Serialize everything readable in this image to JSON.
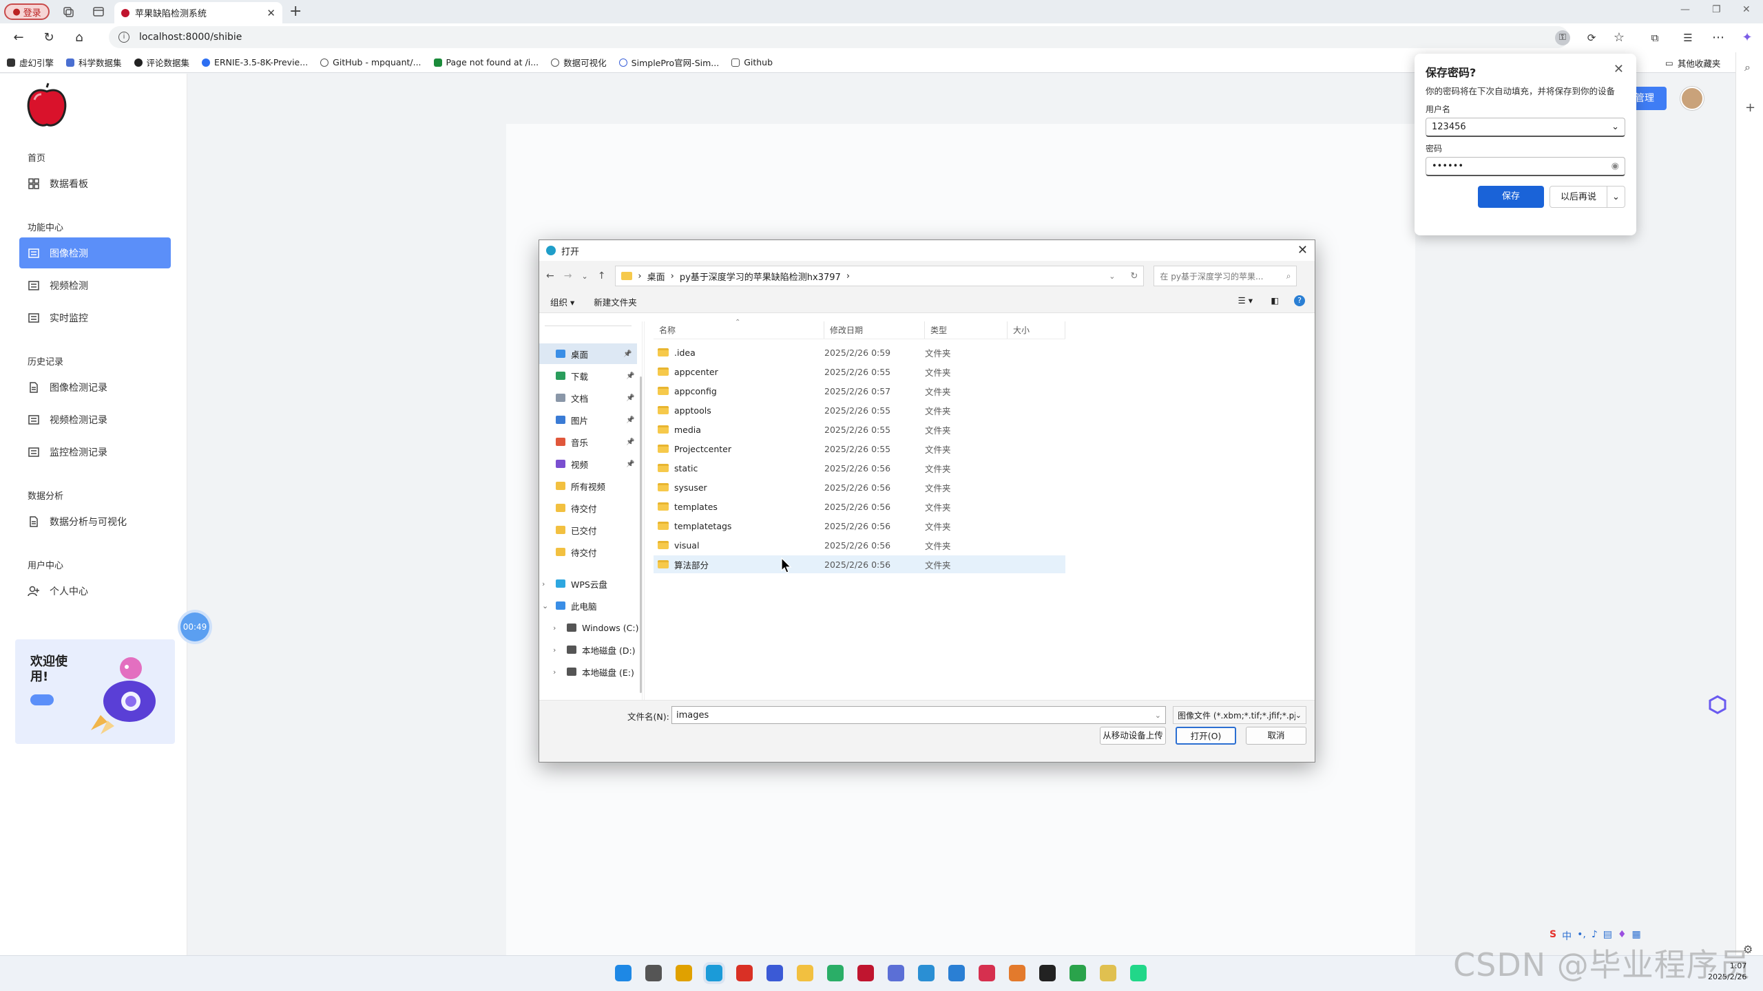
{
  "browser": {
    "profile_label": "登录",
    "tab_title": "苹果缺陷检测系统",
    "url": "localhost:8000/shibie",
    "bookmarks": [
      "虚幻引擎",
      "科学数据集",
      "评论数据集",
      "ERNIE-3.5-8K-Previe...",
      "GitHub - mpquant/...",
      "Page not found at /i...",
      "数据可视化",
      "SimplePro官网-Sim...",
      "Github"
    ],
    "other_bookmarks": "其他收藏夹"
  },
  "sidebar": {
    "sections": [
      {
        "title": "首页",
        "items": [
          {
            "label": "数据看板",
            "icon": "grid-icon"
          }
        ]
      },
      {
        "title": "功能中心",
        "items": [
          {
            "label": "图像检测",
            "icon": "doc-icon",
            "active": true
          },
          {
            "label": "视频检测",
            "icon": "doc-icon"
          },
          {
            "label": "实时监控",
            "icon": "doc-icon"
          }
        ]
      },
      {
        "title": "历史记录",
        "items": [
          {
            "label": "图像检测记录",
            "icon": "file-icon"
          },
          {
            "label": "视频检测记录",
            "icon": "doc-icon"
          },
          {
            "label": "监控检测记录",
            "icon": "doc-icon"
          }
        ]
      },
      {
        "title": "数据分析",
        "items": [
          {
            "label": "数据分析与可视化",
            "icon": "file-icon"
          }
        ]
      },
      {
        "title": "用户中心",
        "items": [
          {
            "label": "个人中心",
            "icon": "user-add-icon"
          }
        ]
      }
    ],
    "welcome": "欢迎使用!",
    "timer": "00:49"
  },
  "header": {
    "manage_label": "管理"
  },
  "password_popup": {
    "title": "保存密码?",
    "desc": "你的密码将在下次自动填充，并将保存到你的设备",
    "username_label": "用户名",
    "username_value": "123456",
    "password_label": "密码",
    "password_value": "••••••",
    "save": "保存",
    "later": "以后再说"
  },
  "dialog": {
    "title": "打开",
    "breadcrumb": [
      "桌面",
      "py基于深度学习的苹果缺陷检测hx3797"
    ],
    "search_placeholder": "在 py基于深度学习的苹果...",
    "organize": "组织 ▾",
    "new_folder": "新建文件夹",
    "tree": [
      {
        "label": "桌面",
        "color": "#3a8ee6",
        "pin": true,
        "selected": true
      },
      {
        "label": "下载",
        "color": "#2a9d5c",
        "pin": true
      },
      {
        "label": "文档",
        "color": "#8a97a8",
        "pin": true
      },
      {
        "label": "图片",
        "color": "#3a7bd5",
        "pin": true
      },
      {
        "label": "音乐",
        "color": "#e0573b",
        "pin": true
      },
      {
        "label": "视频",
        "color": "#7a4fd0",
        "pin": true
      },
      {
        "label": "所有视频",
        "color": "#f2c040"
      },
      {
        "label": "待交付",
        "color": "#f2c040"
      },
      {
        "label": "已交付",
        "color": "#f2c040"
      },
      {
        "label": "待交付",
        "color": "#f2c040"
      },
      {
        "label": "WPS云盘",
        "color": "#2ea7e0",
        "expander": "›"
      },
      {
        "label": "此电脑",
        "color": "#3a8ee6",
        "expander": "⌄"
      },
      {
        "label": "Windows (C:)",
        "color": "#555",
        "expander": "›",
        "indent": true
      },
      {
        "label": "本地磁盘 (D:)",
        "color": "#555",
        "expander": "›",
        "indent": true
      },
      {
        "label": "本地磁盘 (E:)",
        "color": "#555",
        "expander": "›",
        "indent": true
      }
    ],
    "columns": [
      "名称",
      "修改日期",
      "类型",
      "大小"
    ],
    "files": [
      {
        "name": ".idea",
        "date": "2025/2/26 0:59",
        "type": "文件夹"
      },
      {
        "name": "appcenter",
        "date": "2025/2/26 0:55",
        "type": "文件夹"
      },
      {
        "name": "appconfig",
        "date": "2025/2/26 0:57",
        "type": "文件夹"
      },
      {
        "name": "apptools",
        "date": "2025/2/26 0:55",
        "type": "文件夹"
      },
      {
        "name": "media",
        "date": "2025/2/26 0:55",
        "type": "文件夹"
      },
      {
        "name": "Projectcenter",
        "date": "2025/2/26 0:55",
        "type": "文件夹"
      },
      {
        "name": "static",
        "date": "2025/2/26 0:56",
        "type": "文件夹"
      },
      {
        "name": "sysuser",
        "date": "2025/2/26 0:56",
        "type": "文件夹"
      },
      {
        "name": "templates",
        "date": "2025/2/26 0:56",
        "type": "文件夹"
      },
      {
        "name": "templatetags",
        "date": "2025/2/26 0:56",
        "type": "文件夹"
      },
      {
        "name": "visual",
        "date": "2025/2/26 0:56",
        "type": "文件夹"
      },
      {
        "name": "算法部分",
        "date": "2025/2/26 0:56",
        "type": "文件夹",
        "selected": true
      }
    ],
    "filename_label": "文件名(N):",
    "filename_value": "images",
    "filter_value": "图像文件 (*.xbm;*.tif;*.jfif;*.pjp",
    "upload_label": "从移动设备上传",
    "open_label": "打开(O)",
    "cancel_label": "取消"
  },
  "taskbar": {
    "clock_time": "1:07",
    "clock_date": "2025/2/26"
  },
  "watermark": "CSDN @毕业程序员",
  "colors": {
    "accent": "#5b8ff9",
    "save_blue": "#1a63d8",
    "folder": "#f6c94b",
    "apple_red": "#c0152f"
  }
}
